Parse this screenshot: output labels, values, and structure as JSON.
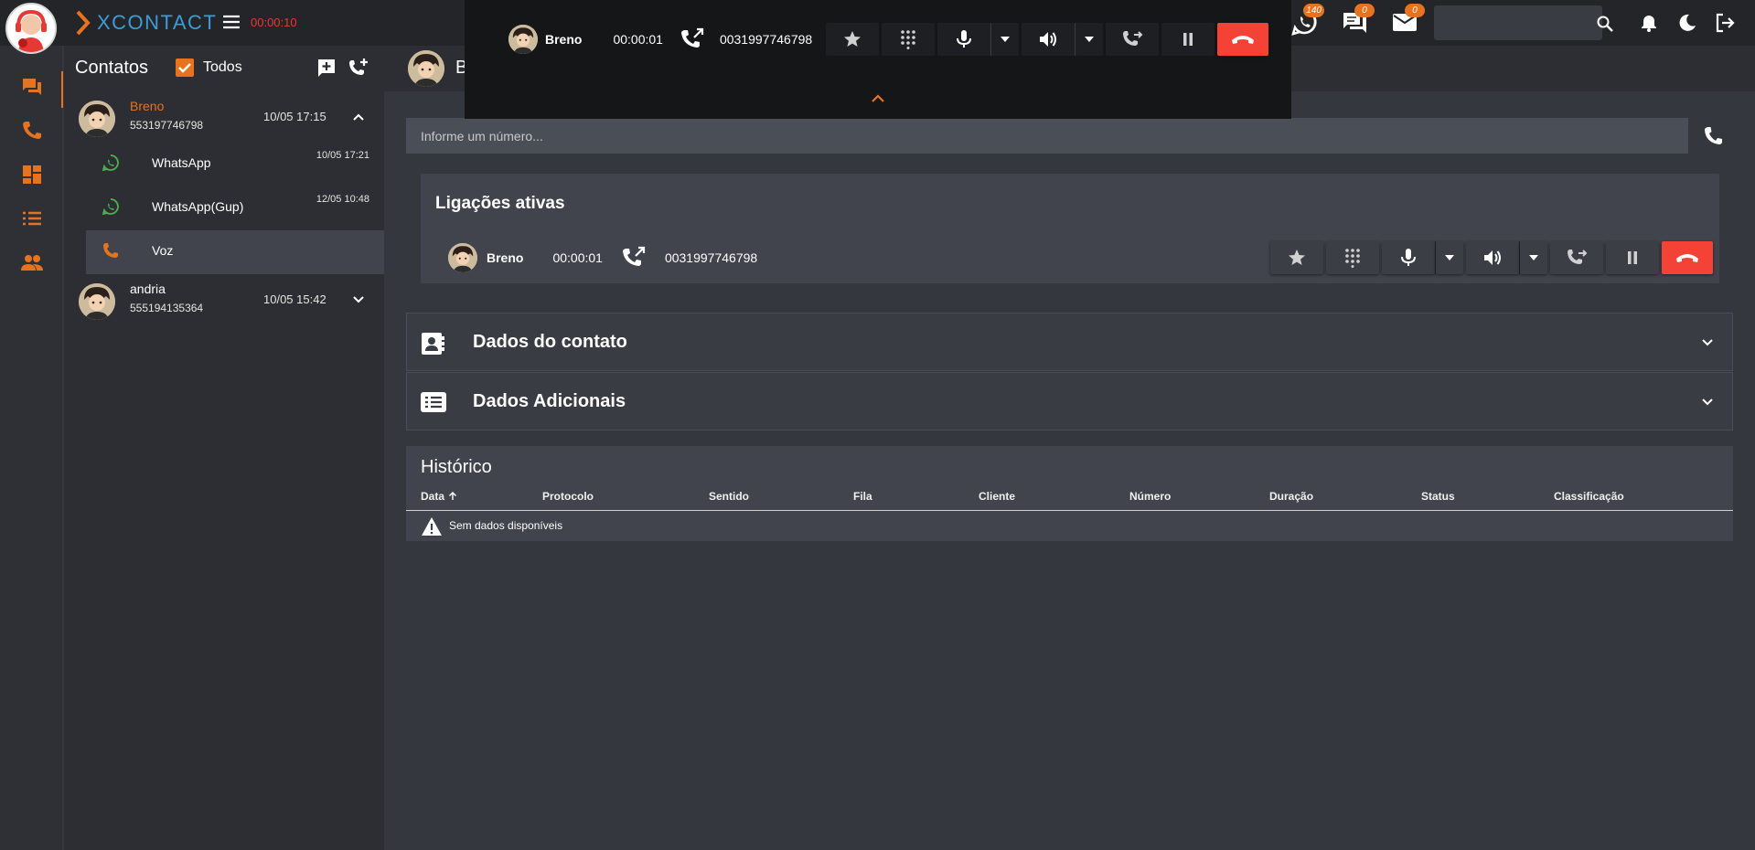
{
  "app": {
    "brand": "XCONTACT",
    "session_timer": "00:00:10"
  },
  "topbar": {
    "whatsapp_badge": "140",
    "chat_badge": "0",
    "mail_badge": "0",
    "search_placeholder": ""
  },
  "contacts": {
    "title": "Contatos",
    "filter_label": "Todos",
    "items": [
      {
        "name": "Breno",
        "number": "553197746798",
        "date": "10/05 17:15",
        "channels": [
          {
            "label": "WhatsApp",
            "date": "10/05 17:21"
          },
          {
            "label": "WhatsApp(Gup)",
            "date": "12/05 10:48"
          },
          {
            "label": "Voz",
            "date": ""
          }
        ]
      },
      {
        "name": "andria",
        "number": "555194135364",
        "date": "10/05 15:42"
      }
    ]
  },
  "main": {
    "header_name": "B",
    "number_placeholder": "Informe um número...",
    "active_calls_title": "Ligações ativas",
    "call": {
      "name": "Breno",
      "duration": "00:00:01",
      "number": "0031997746798"
    },
    "sections": [
      {
        "title": "Dados do contato"
      },
      {
        "title": "Dados Adicionais"
      }
    ],
    "history": {
      "title": "Histórico",
      "columns": [
        "Data",
        "Protocolo",
        "Sentido",
        "Fila",
        "Cliente",
        "Número",
        "Duração",
        "Status",
        "Classificação"
      ],
      "empty_text": "Sem dados disponíveis"
    }
  },
  "callbar": {
    "name": "Breno",
    "duration": "00:00:01",
    "number": "0031997746798"
  },
  "colors": {
    "accent": "#e8731e",
    "end_call": "#f44336",
    "whatsapp": "#4caf50",
    "background": "#35373f"
  }
}
